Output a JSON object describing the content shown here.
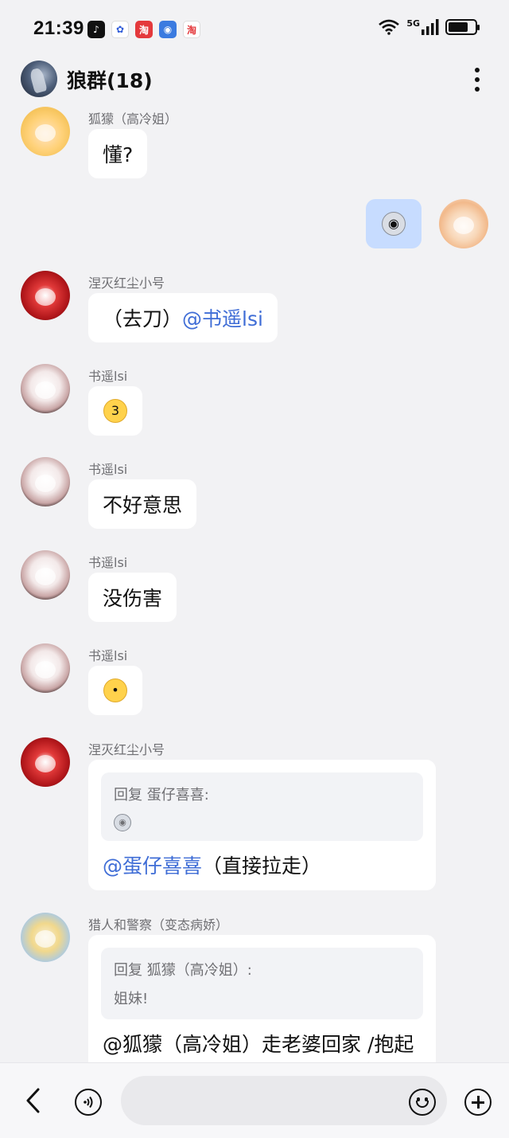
{
  "status_bar": {
    "time": "21:39",
    "apps": [
      {
        "name": "tiktok-icon",
        "color": "#111111",
        "glyph": "♪"
      },
      {
        "name": "baidu-icon",
        "color": "#2f5bd8",
        "glyph": "🐾"
      },
      {
        "name": "taobao-icon",
        "color": "#e4393c",
        "glyph": "淘"
      },
      {
        "name": "finder-icon",
        "color": "#3b7be0",
        "glyph": "◉"
      },
      {
        "name": "taobao2-icon",
        "color": "#e4393c",
        "glyph": "淘"
      }
    ],
    "network": "5G",
    "battery_level": 0.75
  },
  "header": {
    "title": "狼群(18)"
  },
  "messages": [
    {
      "sender": "狐獴（高冷姐）",
      "text": "懂?"
    },
    {
      "sender": "",
      "self": true,
      "emoji": "😱"
    },
    {
      "sender": "涅灭红尘小号",
      "text_prefix": "（去刀）",
      "mention": "@书遥lsi"
    },
    {
      "sender": "书遥lsi",
      "emoji": "😚"
    },
    {
      "sender": "书遥lsi",
      "text": "不好意思"
    },
    {
      "sender": "书遥lsi",
      "text": "没伤害"
    },
    {
      "sender": "书遥lsi",
      "emoji": "😳"
    },
    {
      "sender": "涅灭红尘小号",
      "quote_label": "回复 蛋仔喜喜:",
      "quote_emoji": "😱",
      "mention": "@蛋仔喜喜",
      "text_suffix": "（直接拉走）"
    },
    {
      "sender": "猎人和警察（变态病娇）",
      "quote_label": "回复 狐獴（高冷姐）:",
      "quote_text": "姐妹!",
      "text": "@狐獴（高冷姐）走老婆回家 /抱起"
    }
  ],
  "bottom_bar": {
    "input_placeholder": ""
  }
}
